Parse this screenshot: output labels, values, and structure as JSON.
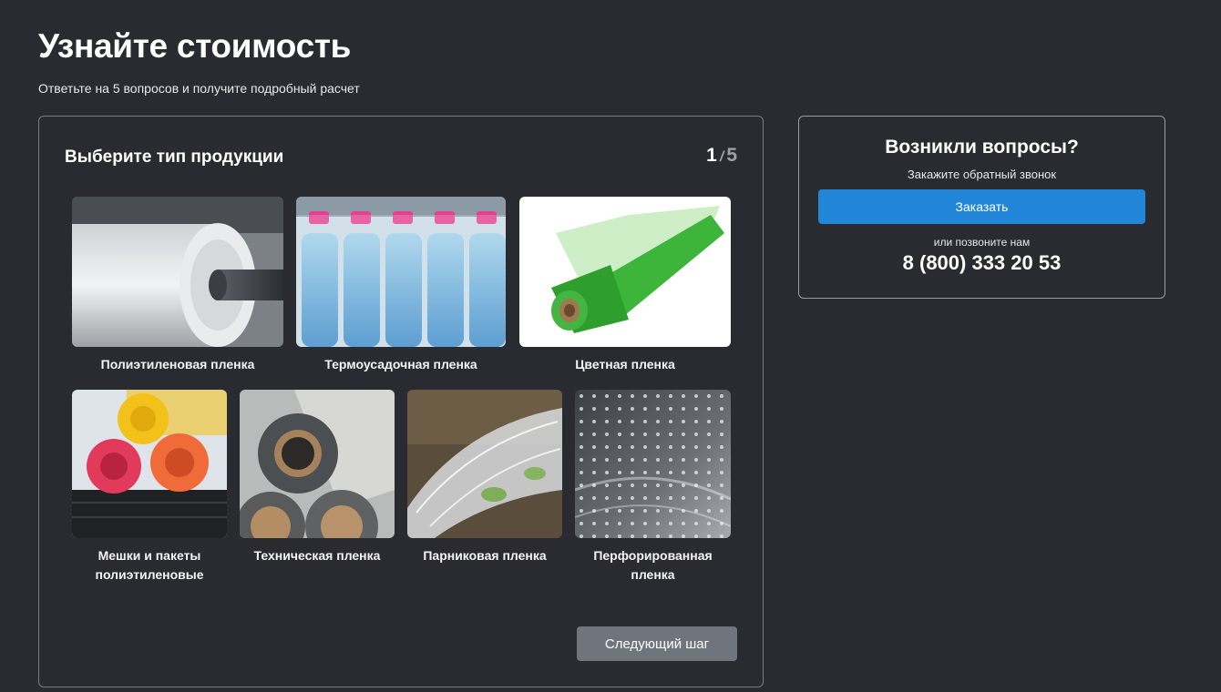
{
  "header": {
    "title": "Узнайте стоимость",
    "subtitle": "Ответьте на 5 вопросов и получите подробный расчет"
  },
  "quiz": {
    "question": "Выберите тип продукции",
    "step_current": "1",
    "step_separator": "/",
    "step_total": "5",
    "options": [
      {
        "label": "Полиэтиленовая пленка",
        "icon": "film-roll-image"
      },
      {
        "label": "Термоусадочная пленка",
        "icon": "bottles-shrink-wrap-image"
      },
      {
        "label": "Цветная пленка",
        "icon": "green-film-roll-image"
      },
      {
        "label": "Мешки и пакеты полиэтиленовые",
        "icon": "colored-bags-image"
      },
      {
        "label": "Техническая пленка",
        "icon": "technical-rolls-image"
      },
      {
        "label": "Парниковая пленка",
        "icon": "greenhouse-tunnel-image"
      },
      {
        "label": "Перфорированная пленка",
        "icon": "perforated-film-image"
      }
    ],
    "next_label": "Следующий шаг"
  },
  "help": {
    "title": "Возникли вопросы?",
    "subtitle": "Закажите обратный звонок",
    "order_label": "Заказать",
    "call_text": "или позвоните нам",
    "phone": "8 (800) 333 20 53"
  },
  "colors": {
    "background": "#2a2b30",
    "accent": "#2185d8",
    "next_button": "#6f757d"
  }
}
